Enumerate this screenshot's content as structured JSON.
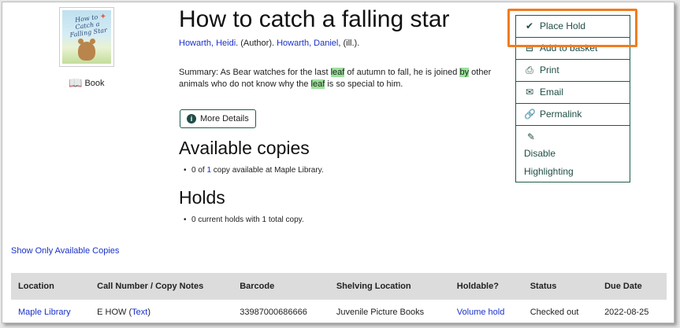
{
  "record": {
    "title": "How to catch a falling star",
    "format": "Book",
    "cover_text": "How to Catch a Falling Star",
    "authors": [
      {
        "name": "Howarth, Heidi",
        "role": ". (Author). "
      },
      {
        "name": "Howarth, Daniel",
        "role": ", (ill.)."
      }
    ],
    "summary": {
      "p1": "Summary: As Bear watches for the last ",
      "hl1": "leaf",
      "p2": " of autumn to fall, he is joined ",
      "hl2": "by",
      "p3": " other animals who do not know why the ",
      "hl3": "leaf",
      "p4": " is so special to him."
    },
    "more_details_label": "More Details"
  },
  "available": {
    "heading": "Available copies",
    "text_pre": "0 of ",
    "count": "1",
    "text_post": " copy available at Maple Library."
  },
  "holds": {
    "heading": "Holds",
    "text": "0 current holds with 1 total copy."
  },
  "actions": {
    "place_hold": "Place Hold",
    "add_to_basket": "Add to basket",
    "print": "Print",
    "email": "Email",
    "permalink": "Permalink",
    "disable_1": "Disable",
    "disable_2": "Highlighting"
  },
  "show_available_link": "Show Only Available Copies",
  "table": {
    "headers": [
      "Location",
      "Call Number / Copy Notes",
      "Barcode",
      "Shelving Location",
      "Holdable?",
      "Status",
      "Due Date"
    ],
    "rows": [
      {
        "location": "Maple Library",
        "call_number": "E HOW (",
        "call_link": "Text",
        "call_close": ")",
        "barcode": "33987000686666",
        "shelving": "Juvenile Picture Books",
        "holdable": "Volume hold",
        "status": "Checked out",
        "due": "2022-08-25"
      }
    ]
  },
  "colors": {
    "link": "#1a31c9",
    "action_border": "#1f5a4f",
    "highlight": "#9be29b",
    "callout": "#f07c21",
    "table_header_bg": "#dcdcdc"
  }
}
